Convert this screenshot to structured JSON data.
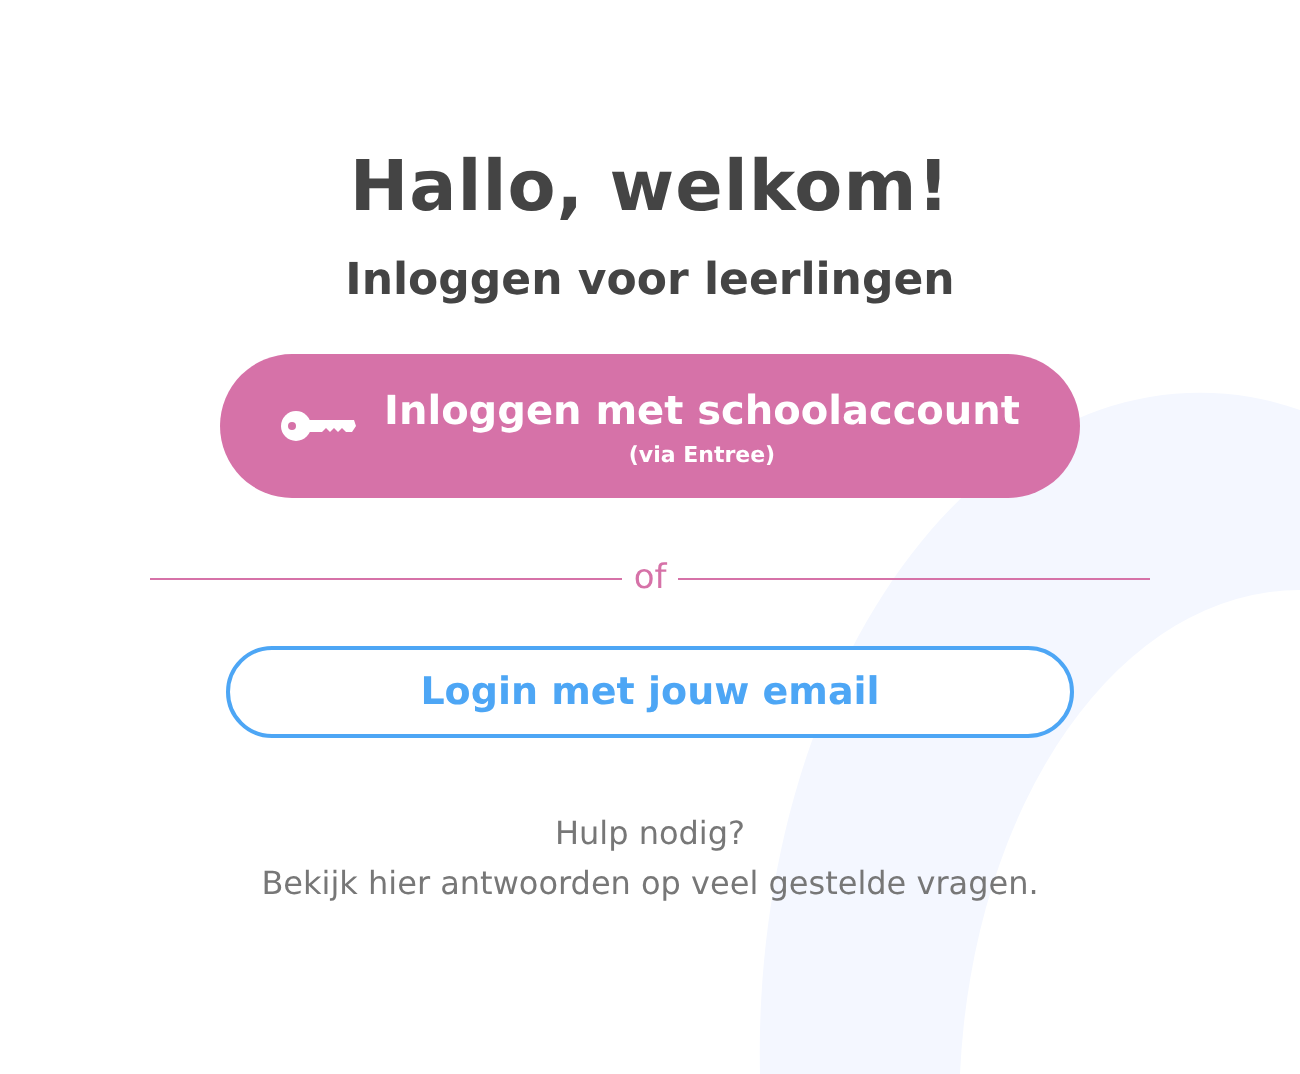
{
  "title": "Hallo, welkom!",
  "subtitle": "Inloggen voor leerlingen",
  "school_button": {
    "label": "Inloggen met schoolaccount",
    "sublabel": "(via Entree)"
  },
  "divider": {
    "label": "of"
  },
  "email_button": {
    "label": "Login met jouw email"
  },
  "help": {
    "question": "Hulp nodig?",
    "link": "Bekijk hier antwoorden op veel gestelde vragen."
  }
}
